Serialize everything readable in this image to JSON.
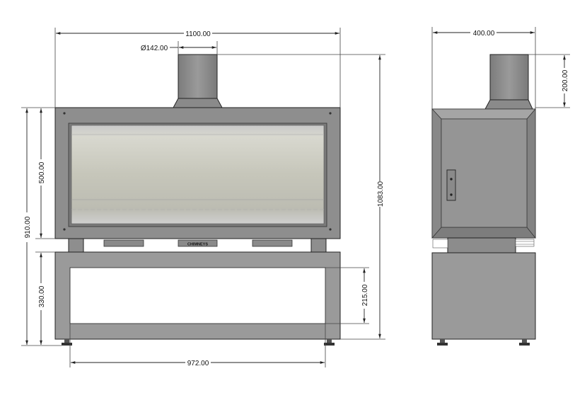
{
  "dimensions": {
    "total_width": "1100.00",
    "flue_diameter": "Ø142.00",
    "total_height": "1083.00",
    "firebox_height": "910.00",
    "glass_height": "500.00",
    "stand_height": "330.00",
    "stand_opening_height": "215.00",
    "stand_inner_width": "972.00",
    "depth": "400.00",
    "flue_height": "200.00"
  },
  "labels": {
    "brand_plate": "CHIMNEYS"
  },
  "colors": {
    "frame": "#8e8e8e",
    "frame_dark": "#6f6f6f",
    "glass": "#c8c8be",
    "stand": "#9a9a9a",
    "side_body": "#939393",
    "line": "#222222"
  }
}
